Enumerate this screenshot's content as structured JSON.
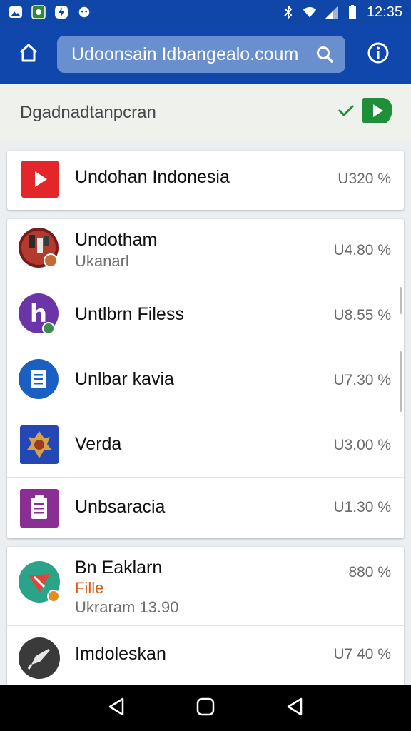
{
  "status_bar": {
    "time": "12:35",
    "left_icons": [
      "photos-icon",
      "android-app-icon",
      "bolt-icon",
      "face-icon"
    ],
    "right_icons": [
      "bluetooth-icon",
      "wifi-icon",
      "signal-icon",
      "battery-icon"
    ]
  },
  "app_bar": {
    "search_text": "Udoonsain Idbangealo.coum",
    "home_icon": "home-icon",
    "search_icon": "search-icon",
    "info_icon": "info-icon"
  },
  "banner": {
    "text": "Dgadnadtanpcran",
    "check_icon": "check-icon",
    "badge_icon": "play-badge-icon"
  },
  "colors": {
    "app_bar": "#0f47ad",
    "search_box": "#6a8fcf",
    "accent_orange": "#d2601a",
    "banner_bg": "#eef1ec"
  },
  "cards": [
    {
      "rows": [
        {
          "title": "Undohan Indonesia",
          "subtitle": "",
          "accent": "",
          "value": "U320 %",
          "icon": "youtube-icon"
        }
      ]
    },
    {
      "rows": [
        {
          "title": "Undotham",
          "subtitle": "Ukanarl",
          "accent": "",
          "value": "U4.80 %",
          "icon": "avatar-photo-icon"
        },
        {
          "title": "Untlbrn Filess",
          "subtitle": "",
          "accent": "",
          "value": "U8.55 %",
          "icon": "h-letter-app-icon"
        },
        {
          "title": "Unlbar kavia",
          "subtitle": "",
          "accent": "",
          "value": "U7.30 %",
          "icon": "document-app-icon"
        },
        {
          "title": "Verda",
          "subtitle": "",
          "accent": "",
          "value": "U3.00 %",
          "icon": "emblem-app-icon"
        },
        {
          "title": "Unbsaracia",
          "subtitle": "",
          "accent": "",
          "value": "U1.30 %",
          "icon": "clipboard-app-icon"
        }
      ]
    },
    {
      "rows": [
        {
          "title": "Bn Eaklarn",
          "subtitle": "Ukraram 13.90",
          "accent": "Fille",
          "value": "880 %",
          "icon": "flag-app-icon"
        },
        {
          "title": "Imdoleskan",
          "subtitle": "",
          "accent": "",
          "value": "U7 40 %",
          "icon": "rocket-app-icon"
        }
      ]
    }
  ],
  "nav_bar": {
    "back_icon": "back-icon",
    "home_icon": "nav-home-icon",
    "recents_icon": "recents-icon"
  }
}
